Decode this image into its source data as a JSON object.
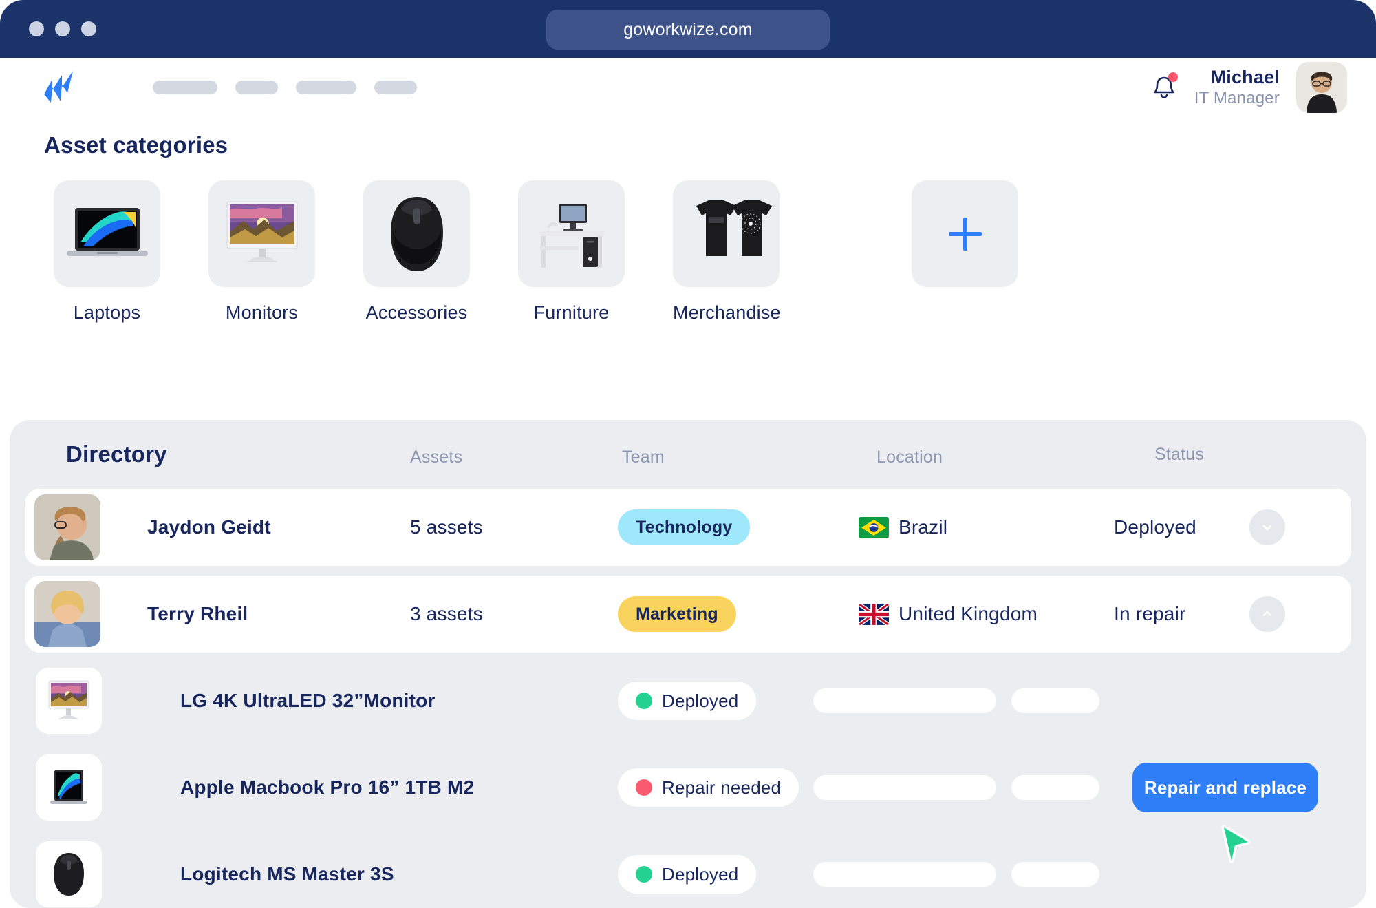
{
  "browser": {
    "url": "goworkwize.com",
    "traffic_lights": [
      "close",
      "minimize",
      "maximize"
    ]
  },
  "header": {
    "logo_name": "workwize-logo",
    "nav_placeholders": 4,
    "notification_icon": "bell-icon",
    "has_notification_dot": true,
    "user": {
      "name": "Michael",
      "role": "IT Manager",
      "avatar": "user-avatar"
    }
  },
  "categories_section": {
    "title": "Asset categories",
    "add_button_label": "+",
    "items": [
      {
        "label": "Laptops",
        "icon": "laptop-image"
      },
      {
        "label": "Monitors",
        "icon": "monitor-image"
      },
      {
        "label": "Accessories",
        "icon": "mouse-image"
      },
      {
        "label": "Furniture",
        "icon": "desk-image"
      },
      {
        "label": "Merchandise",
        "icon": "tshirt-image"
      }
    ]
  },
  "directory": {
    "title": "Directory",
    "columns": [
      "Assets",
      "Team",
      "Location",
      "Status"
    ],
    "rows": [
      {
        "name": "Jaydon Geidt",
        "assets": "5 assets",
        "team": "Technology",
        "team_color": "#9fe8fb",
        "location": "Brazil",
        "flag": "brazil-flag",
        "status": "Deployed",
        "expanded": false,
        "toggle_icon": "chevron-down-icon"
      },
      {
        "name": "Terry Rheil",
        "assets": "3 assets",
        "team": "Marketing",
        "team_color": "#f8d45f",
        "location": "United Kingdom",
        "flag": "uk-flag",
        "status": "In repair",
        "expanded": true,
        "toggle_icon": "chevron-up-icon"
      }
    ],
    "expanded_assets": [
      {
        "name": "LG 4K UltraLED 32”Monitor",
        "thumb": "monitor-thumb",
        "status": "Deployed",
        "status_color": "#25d191",
        "action": null
      },
      {
        "name": "Apple Macbook Pro 16” 1TB M2",
        "thumb": "laptop-thumb",
        "status": "Repair needed",
        "status_color": "#fa5a6e",
        "action": "Repair and replace"
      },
      {
        "name": "Logitech MS Master 3S",
        "thumb": "mouse-thumb",
        "status": "Deployed",
        "status_color": "#25d191",
        "action": null
      }
    ]
  },
  "colors": {
    "chrome": "#1b3368",
    "accent": "#2d7ef7",
    "navy_text": "#17265c",
    "panel": "#ebedf1",
    "tile": "#eceef2",
    "muted_text": "#8e97b0",
    "green": "#25d191",
    "red": "#fa5a6e",
    "cursor": "#25d191"
  }
}
